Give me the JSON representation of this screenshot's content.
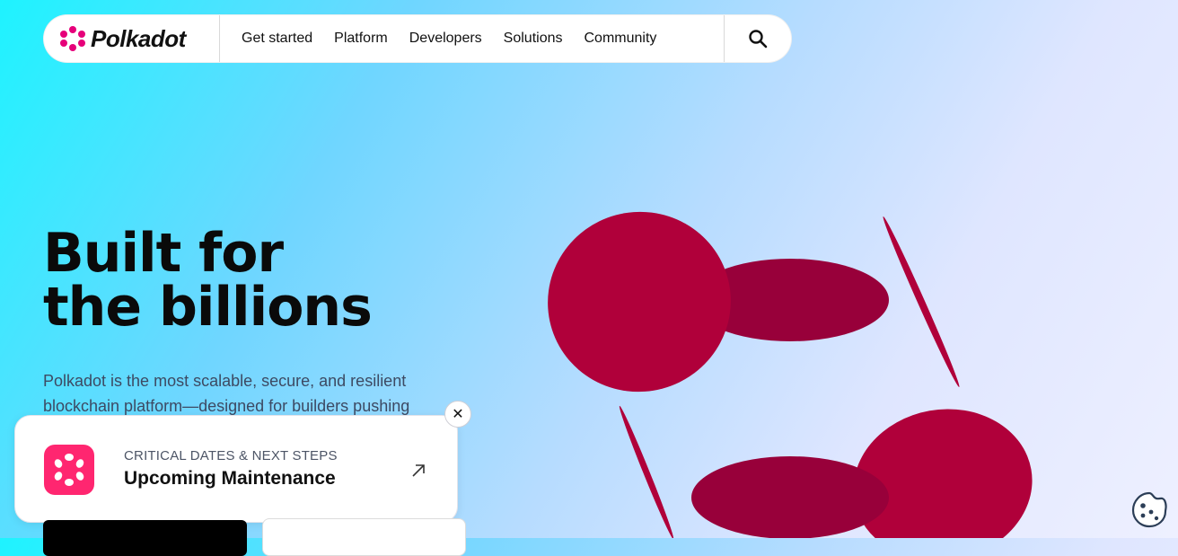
{
  "brand": {
    "name": "Polkadot",
    "icon": "polkadot-logo-icon"
  },
  "nav": {
    "items": [
      "Get started",
      "Platform",
      "Developers",
      "Solutions",
      "Community"
    ],
    "search_icon": "search-icon"
  },
  "hero": {
    "title_line1": "Built for",
    "title_line2": "the billions",
    "subtitle": "Polkadot is the most scalable, secure, and resilient blockchain platform—designed for builders pushing"
  },
  "banner": {
    "kicker": "CRITICAL DATES & NEXT STEPS",
    "title": "Upcoming Maintenance",
    "icon": "polkadot-logo-icon",
    "link_icon": "arrow-up-right-icon",
    "close_label": "✕"
  },
  "colors": {
    "accent": "#e6007a",
    "disc": "#b0003a",
    "disc_dark": "#98003a"
  },
  "cookie": {
    "icon": "cookie-icon"
  }
}
